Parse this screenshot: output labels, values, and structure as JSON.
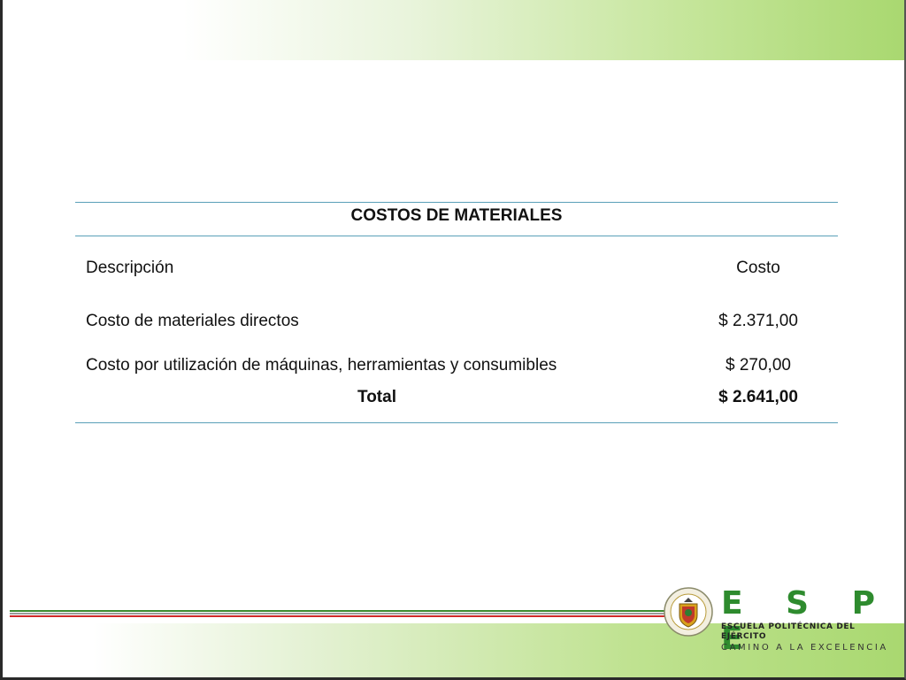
{
  "table": {
    "title": "COSTOS DE MATERIALES",
    "header": {
      "description": "Descripción",
      "cost": "Costo"
    },
    "rows": [
      {
        "description": "Costo de materiales directos",
        "cost": "$ 2.371,00"
      },
      {
        "description": "Costo por utilización de máquinas, herramientas y consumibles",
        "cost": "$ 270,00"
      }
    ],
    "total": {
      "label": "Total",
      "cost": "$ 2.641,00"
    }
  },
  "logo": {
    "name": "E S P E",
    "subtitle": "ESCUELA POLITÉCNICA DEL EJÉRCITO",
    "tagline": "CAMINO A LA EXCELENCIA",
    "seal_icon": "espe-seal-icon"
  },
  "colors": {
    "accent_green": "#a9d870",
    "rule_blue": "#5aa0b8",
    "logo_green": "#2e8b2e",
    "stripe_red": "#d02828"
  }
}
